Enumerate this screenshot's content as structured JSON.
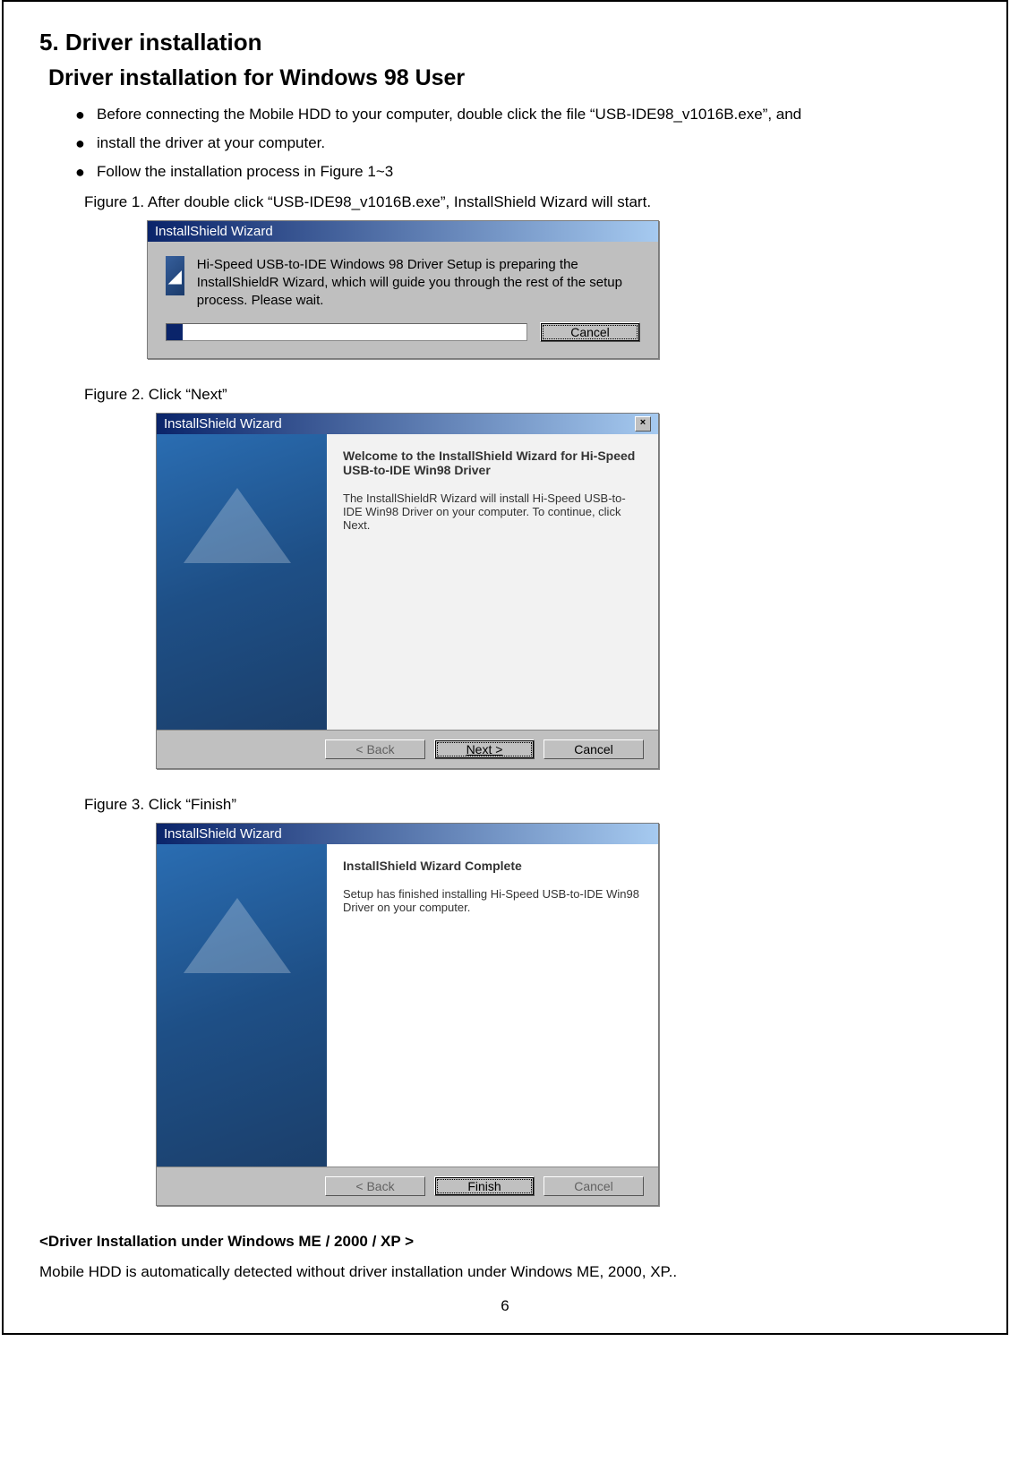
{
  "section_title": "5. Driver installation",
  "subtitle": "Driver installation for Windows 98 User",
  "bullets": [
    "Before connecting the Mobile HDD to your computer, double click the file “USB-IDE98_v1016B.exe”, and",
    "install the driver at your computer.",
    "Follow the installation process in Figure 1~3"
  ],
  "fig1_caption": "Figure 1. After double click “USB-IDE98_v1016B.exe”, InstallShield Wizard will start.",
  "fig2_caption": "Figure 2. Click “Next”",
  "fig3_caption": "Figure 3. Click “Finish”",
  "win1": {
    "title": "InstallShield Wizard",
    "body": "Hi-Speed USB-to-IDE Windows 98 Driver Setup is preparing the InstallShieldR Wizard, which will guide you through the rest of the setup process. Please wait.",
    "cancel": "Cancel"
  },
  "win2": {
    "title": "InstallShield Wizard",
    "heading": "Welcome to the InstallShield Wizard for Hi-Speed USB-to-IDE Win98 Driver",
    "body": "The InstallShieldR Wizard will install Hi-Speed USB-to-IDE Win98 Driver on your computer. To continue, click Next.",
    "back": "< Back",
    "next": "Next >",
    "cancel": "Cancel",
    "close_x": "×"
  },
  "win3": {
    "title": "InstallShield Wizard",
    "heading": "InstallShield Wizard Complete",
    "body": "Setup has finished installing Hi-Speed USB-to-IDE Win98 Driver on your computer.",
    "back": "< Back",
    "finish": "Finish",
    "cancel": "Cancel"
  },
  "sub_heading": "<Driver Installation under Windows ME / 2000 / XP >",
  "sub_body": "Mobile HDD is automatically detected without driver installation under Windows ME, 2000, XP..",
  "page_number": "6"
}
